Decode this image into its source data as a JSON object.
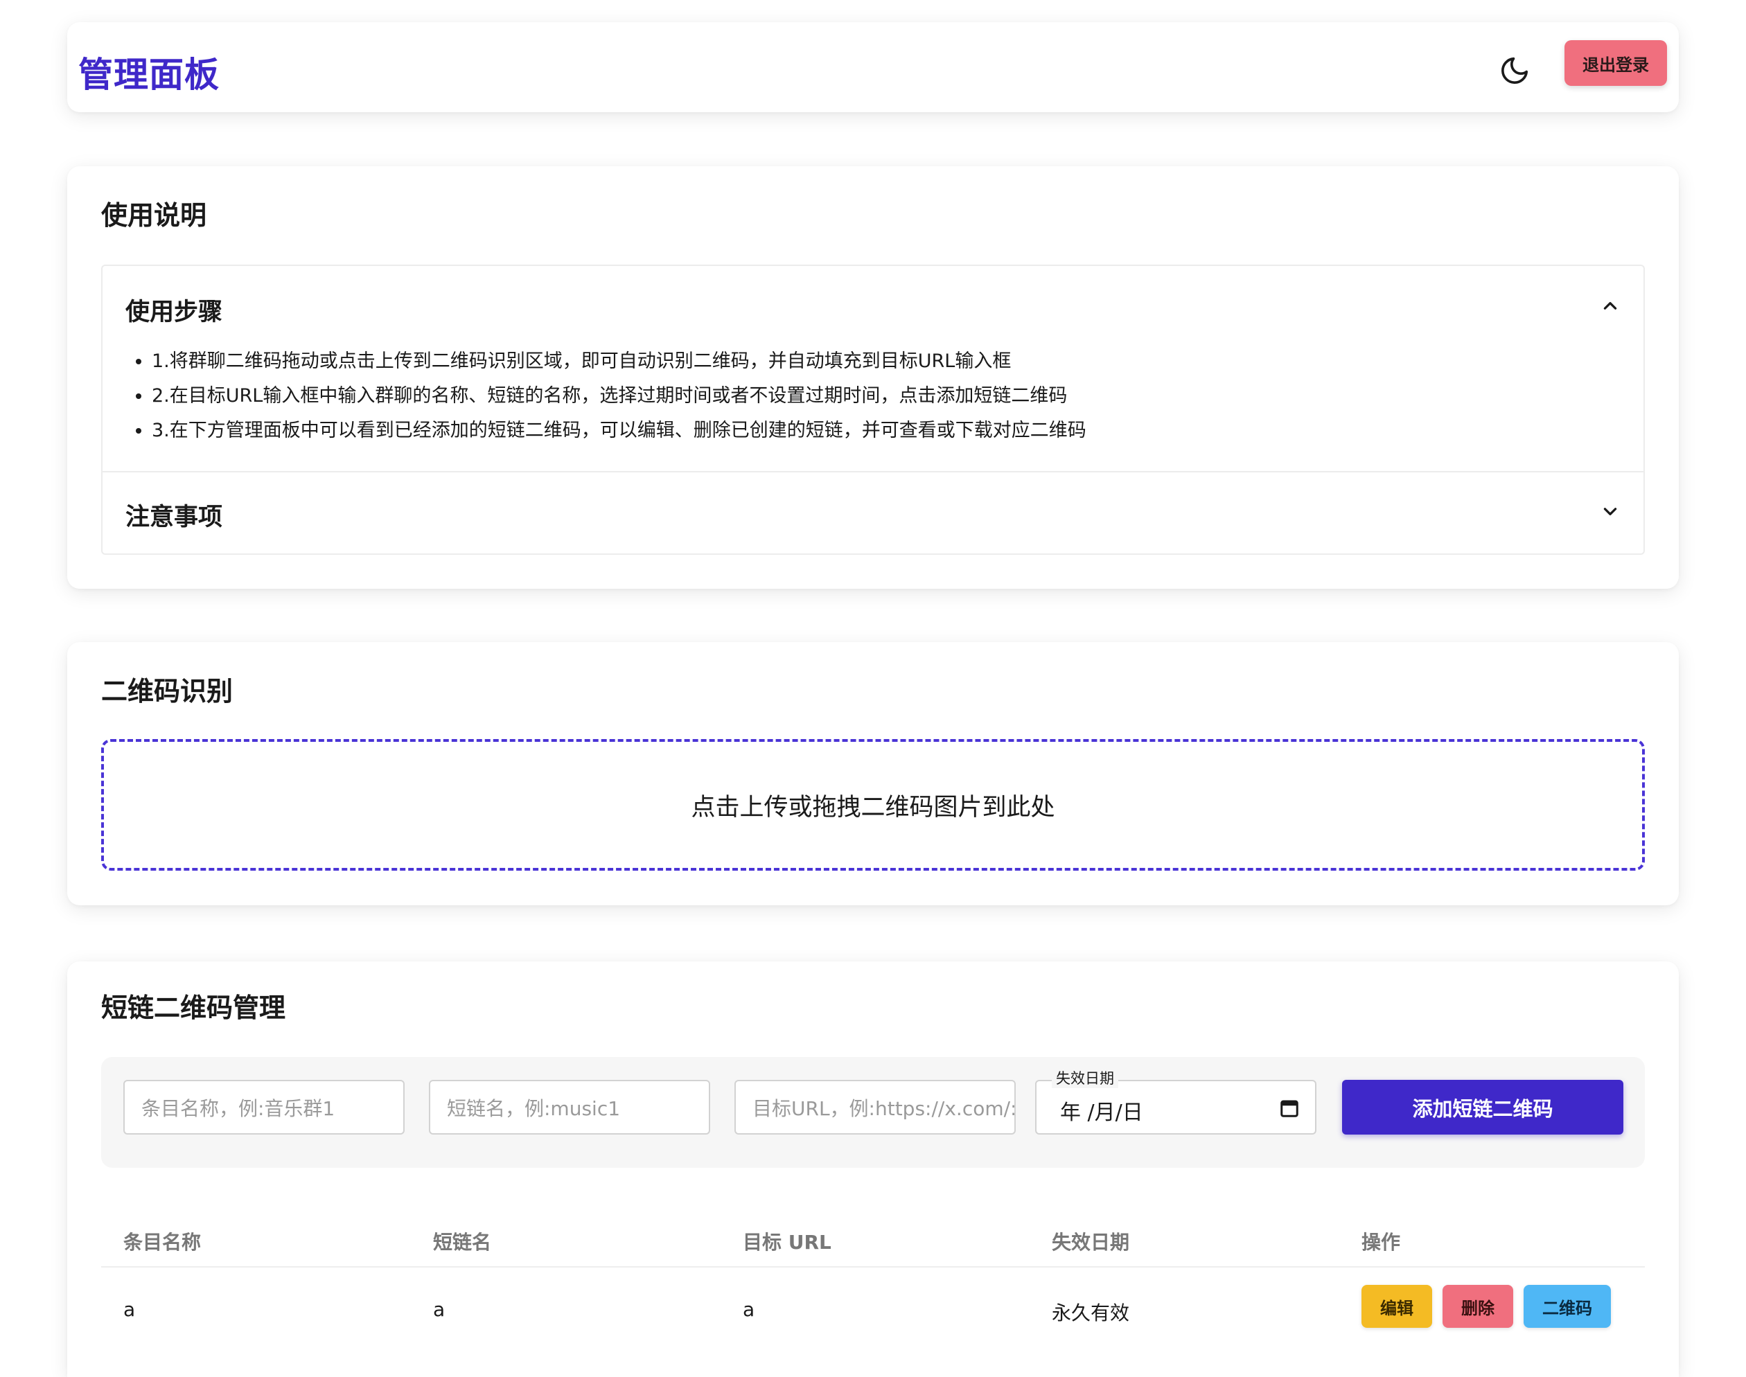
{
  "header": {
    "title": "管理面板",
    "logout_label": "退出登录",
    "theme_icon": "moon-icon"
  },
  "usage": {
    "title": "使用说明",
    "steps": {
      "heading": "使用步骤",
      "items": [
        "1.将群聊二维码拖动或点击上传到二维码识别区域，即可自动识别二维码，并自动填充到目标URL输入框",
        "2.在目标URL输入框中输入群聊的名称、短链的名称，选择过期时间或者不设置过期时间，点击添加短链二维码",
        "3.在下方管理面板中可以看到已经添加的短链二维码，可以编辑、删除已创建的短链，并可查看或下载对应二维码"
      ]
    },
    "notes": {
      "heading": "注意事项"
    }
  },
  "qr": {
    "title": "二维码识别",
    "dropzone_text": "点击上传或拖拽二维码图片到此处"
  },
  "manage": {
    "title": "短链二维码管理",
    "form": {
      "name_placeholder": "条目名称，例:音乐群1",
      "short_placeholder": "短链名，例:music1",
      "url_placeholder": "目标URL，例:https://x.com/:",
      "date_label": "失效日期",
      "date_value": "年 /月/日",
      "add_label": "添加短链二维码"
    },
    "columns": [
      "条目名称",
      "短链名",
      "目标 URL",
      "失效日期",
      "操作"
    ],
    "rows": [
      {
        "name": "a",
        "short": "a",
        "url": "a",
        "expiry": "永久有效",
        "actions": {
          "edit": "编辑",
          "delete": "删除",
          "qrcode": "二维码"
        }
      }
    ]
  },
  "colors": {
    "brand": "#3f28c9",
    "logout": "#f06f7e",
    "edit": "#f4bb24",
    "delete": "#f06f7e",
    "qrcode": "#4fb7f5"
  }
}
